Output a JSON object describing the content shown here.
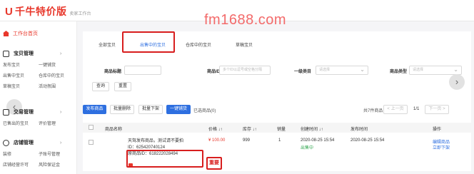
{
  "header": {
    "logo_mark": "U",
    "logo_title": "千牛特价版",
    "logo_sub": "卖家工作台",
    "watermark": "fm1688.com"
  },
  "sidebar": {
    "home_label": "工作台首页",
    "groups": [
      {
        "title": "宝贝管理",
        "rows": [
          [
            "发布宝贝",
            "一键铺货"
          ],
          [
            "出售中宝贝",
            "仓库中的宝贝"
          ],
          [
            "草稿宝贝",
            "活动氛围"
          ]
        ]
      },
      {
        "title": "交易管理",
        "rows": [
          [
            "已售出的宝贝",
            "评价管理"
          ]
        ]
      },
      {
        "title": "店铺管理",
        "rows": [
          [
            "装修",
            "子账号管理"
          ],
          [
            "店铺经营许可",
            "风险保证金"
          ]
        ]
      }
    ],
    "collapse_icon": "‹"
  },
  "tabs": [
    {
      "label": "全部宝贝",
      "active": false
    },
    {
      "label": "出售中的宝贝",
      "active": true
    },
    {
      "label": "仓库中的宝贝",
      "active": false
    },
    {
      "label": "草稿宝贝",
      "active": false
    }
  ],
  "filter": {
    "name_label": "商品标题",
    "name_value": "",
    "id_label": "商品ID",
    "id_placeholder": "多个ID以逗号或空格分隔",
    "cat_label": "一级类目",
    "cat_placeholder": "请选择",
    "type_label": "商品类型",
    "type_placeholder": "请选择",
    "query_label": "查询",
    "reset_label": "重置",
    "next_icon": "›"
  },
  "toolbar": {
    "publish": "发布商品",
    "batch_delete": "批量删除",
    "batch_offline": "批量下架",
    "one_key": "一键铺货",
    "selected_prefix": "已选商品(",
    "selected_count": "0",
    "selected_suffix": ")",
    "total_text": "共7件商品",
    "prev_page": "< 上一页",
    "page_info": "1/1",
    "next_page": "下一页 >"
  },
  "table": {
    "headers": [
      "商品名称",
      "价格 ↓↑",
      "库存 ↓↑",
      "销量",
      "创建时间 ↓↑",
      "发布时间",
      "操作"
    ],
    "rows": [
      {
        "title_line1": "天驾发布商品，测试请不要拍",
        "title_line2": "ID：625420740124",
        "origin_id": "原商品ID：618222028494",
        "price": "¥ 100.00",
        "stock": "999",
        "sales": "1",
        "created": "2020-08-25 15:54",
        "status": "出售中",
        "published": "2020-08-25 15:54",
        "op1": "编辑商品",
        "op2": "立即下架"
      }
    ]
  },
  "annotation": {
    "important_label": "重要"
  },
  "colors": {
    "brand_red": "#e8382c",
    "primary_blue": "#2e6fe0",
    "status_green": "#35a852",
    "highlight_red": "#d81e1e"
  }
}
